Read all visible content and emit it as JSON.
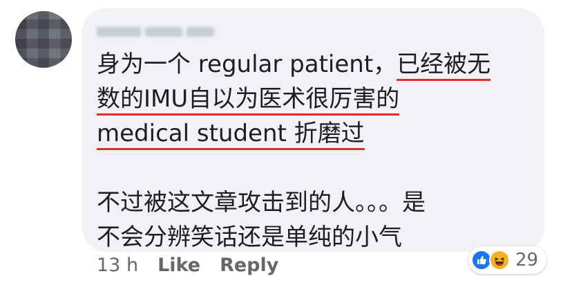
{
  "comment": {
    "author_name": "",
    "lines": [
      {
        "plain": "身为一个 regular patient，",
        "highlight": "已经被无"
      },
      {
        "plain": "",
        "highlight": "数的IMU自以为医术很厉害的"
      },
      {
        "plain": "",
        "highlight": "medical student 折磨过"
      }
    ],
    "paragraph2": [
      "不过被这文章攻击到的人。。。是",
      "不会分辨笑话还是单纯的小气"
    ]
  },
  "meta": {
    "time": "13 h",
    "like_label": "Like",
    "reply_label": "Reply"
  },
  "reactions": {
    "icons": [
      "like-icon",
      "haha-icon"
    ],
    "count": "29"
  },
  "colors": {
    "bubble": "#f0f2f5",
    "text": "#1c1e21",
    "meta": "#65676b",
    "underline": "#d93025",
    "like_blue": "#1877f2",
    "haha_yellow": "#f7b125"
  }
}
